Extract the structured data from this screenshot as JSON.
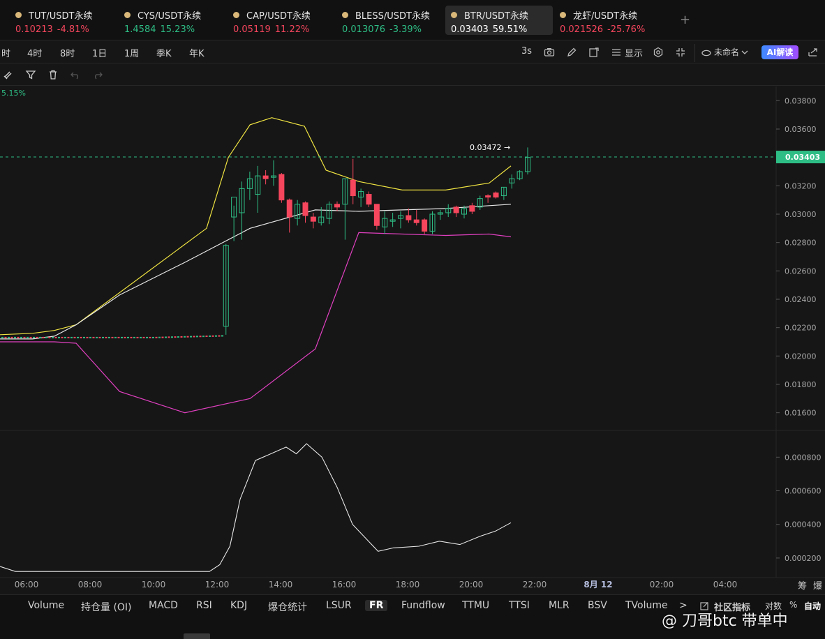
{
  "tabs": [
    {
      "pair": "TUT/USDT永续",
      "price": "0.10213",
      "change": "-4.81%",
      "dir": "down"
    },
    {
      "pair": "CYS/USDT永续",
      "price": "1.4584",
      "change": "15.23%",
      "dir": "up"
    },
    {
      "pair": "CAP/USDT永续",
      "price": "0.05119",
      "change": "11.22%",
      "dir": "down"
    },
    {
      "pair": "BLESS/USDT永续",
      "price": "0.013076",
      "change": "-3.39%",
      "dir": "up"
    },
    {
      "pair": "BTR/USDT永续",
      "price": "0.03403",
      "change": "59.51%",
      "dir": "active"
    },
    {
      "pair": "龙虾/USDT永续",
      "price": "0.021526",
      "change": "-25.76%",
      "dir": "down"
    }
  ],
  "add_tab": "+",
  "timeframes": [
    "时",
    "4时",
    "8时",
    "1日",
    "1周",
    "季K",
    "年K"
  ],
  "toolbar": {
    "interval": "3s",
    "display_label": "显示",
    "layout_name": "未命名",
    "ai_label": "AI解读"
  },
  "chart": {
    "change_label": "5.15%",
    "high_label": "0.03472 →",
    "last_price": "0.03403",
    "price_ticks": [
      "0.03800",
      "0.03600",
      "0.03400",
      "0.03200",
      "0.03000",
      "0.02800",
      "0.02600",
      "0.02400",
      "0.02200",
      "0.02000",
      "0.01800",
      "0.01600"
    ],
    "fr_ticks": [
      "0.000800",
      "0.000600",
      "0.000400",
      "0.000200"
    ],
    "time_ticks": [
      "06:00",
      "08:00",
      "10:00",
      "12:00",
      "14:00",
      "16:00",
      "18:00",
      "20:00",
      "22:00",
      "8月 12",
      "02:00",
      "04:00"
    ],
    "corner_labels": [
      "筹",
      "爆"
    ],
    "colors": {
      "up": "#2ebd85",
      "down": "#f6465d",
      "upper_band": "#f0e442",
      "mid_band": "#e6e6e6",
      "lower_band": "#e040c0",
      "last_price": "#2ebd85"
    }
  },
  "chart_data": {
    "type": "candlestick",
    "price_axis": {
      "min": 0.015,
      "max": 0.039,
      "unit": "USDT"
    },
    "fr_axis": {
      "min": 0.0001,
      "max": 0.00093
    },
    "last_price": 0.03403,
    "high_marker": 0.03472,
    "candles": [
      {
        "t": "12:30",
        "o": 0.0221,
        "h": 0.0279,
        "l": 0.0215,
        "c": 0.0278
      },
      {
        "t": "12:45",
        "o": 0.0298,
        "h": 0.0306,
        "l": 0.0281,
        "c": 0.0312
      },
      {
        "t": "13:00",
        "o": 0.0301,
        "h": 0.0323,
        "l": 0.0282,
        "c": 0.0318
      },
      {
        "t": "13:15",
        "o": 0.0318,
        "h": 0.033,
        "l": 0.031,
        "c": 0.0325
      },
      {
        "t": "13:30",
        "o": 0.0314,
        "h": 0.0334,
        "l": 0.0301,
        "c": 0.0327
      },
      {
        "t": "13:45",
        "o": 0.0327,
        "h": 0.0331,
        "l": 0.0321,
        "c": 0.0325
      },
      {
        "t": "14:00",
        "o": 0.0326,
        "h": 0.0338,
        "l": 0.032,
        "c": 0.0327
      },
      {
        "t": "14:15",
        "o": 0.0328,
        "h": 0.0329,
        "l": 0.0308,
        "c": 0.031
      },
      {
        "t": "14:30",
        "o": 0.031,
        "h": 0.0311,
        "l": 0.0287,
        "c": 0.0298
      },
      {
        "t": "14:45",
        "o": 0.0297,
        "h": 0.031,
        "l": 0.0292,
        "c": 0.0307
      },
      {
        "t": "15:00",
        "o": 0.0308,
        "h": 0.0309,
        "l": 0.0294,
        "c": 0.0299
      },
      {
        "t": "15:15",
        "o": 0.0298,
        "h": 0.0301,
        "l": 0.029,
        "c": 0.0295
      },
      {
        "t": "15:30",
        "o": 0.0294,
        "h": 0.0305,
        "l": 0.0292,
        "c": 0.0298
      },
      {
        "t": "15:45",
        "o": 0.0297,
        "h": 0.0309,
        "l": 0.0293,
        "c": 0.0307
      },
      {
        "t": "16:00",
        "o": 0.0307,
        "h": 0.0309,
        "l": 0.0302,
        "c": 0.0305
      },
      {
        "t": "16:15",
        "o": 0.0307,
        "h": 0.0325,
        "l": 0.0282,
        "c": 0.0325
      },
      {
        "t": "16:30",
        "o": 0.0324,
        "h": 0.0339,
        "l": 0.0307,
        "c": 0.0313
      },
      {
        "t": "16:45",
        "o": 0.0312,
        "h": 0.0318,
        "l": 0.0305,
        "c": 0.0316
      },
      {
        "t": "17:00",
        "o": 0.0314,
        "h": 0.0316,
        "l": 0.0305,
        "c": 0.0307
      },
      {
        "t": "17:15",
        "o": 0.0307,
        "h": 0.0307,
        "l": 0.0289,
        "c": 0.0292
      },
      {
        "t": "17:30",
        "o": 0.0291,
        "h": 0.0302,
        "l": 0.0286,
        "c": 0.0297
      },
      {
        "t": "17:45",
        "o": 0.0295,
        "h": 0.0301,
        "l": 0.0291,
        "c": 0.0296
      },
      {
        "t": "18:00",
        "o": 0.0297,
        "h": 0.0302,
        "l": 0.029,
        "c": 0.0299
      },
      {
        "t": "18:15",
        "o": 0.0299,
        "h": 0.0304,
        "l": 0.0294,
        "c": 0.0296
      },
      {
        "t": "18:30",
        "o": 0.0296,
        "h": 0.0303,
        "l": 0.0292,
        "c": 0.0294
      },
      {
        "t": "18:45",
        "o": 0.0296,
        "h": 0.0297,
        "l": 0.0286,
        "c": 0.0288
      },
      {
        "t": "19:00",
        "o": 0.0288,
        "h": 0.0302,
        "l": 0.0286,
        "c": 0.03
      },
      {
        "t": "19:15",
        "o": 0.03,
        "h": 0.0303,
        "l": 0.0296,
        "c": 0.0301
      },
      {
        "t": "19:30",
        "o": 0.0301,
        "h": 0.0307,
        "l": 0.0298,
        "c": 0.0304
      },
      {
        "t": "19:45",
        "o": 0.0305,
        "h": 0.0306,
        "l": 0.0298,
        "c": 0.0301
      },
      {
        "t": "20:00",
        "o": 0.03,
        "h": 0.0306,
        "l": 0.0297,
        "c": 0.0304
      },
      {
        "t": "20:15",
        "o": 0.0306,
        "h": 0.0308,
        "l": 0.03,
        "c": 0.0302
      },
      {
        "t": "20:30",
        "o": 0.0305,
        "h": 0.0313,
        "l": 0.0303,
        "c": 0.0311
      },
      {
        "t": "20:45",
        "o": 0.0313,
        "h": 0.0314,
        "l": 0.0308,
        "c": 0.0312
      },
      {
        "t": "21:00",
        "o": 0.0315,
        "h": 0.0316,
        "l": 0.0311,
        "c": 0.0312
      },
      {
        "t": "21:15",
        "o": 0.0313,
        "h": 0.0319,
        "l": 0.031,
        "c": 0.0319
      },
      {
        "t": "21:30",
        "o": 0.0322,
        "h": 0.0328,
        "l": 0.0318,
        "c": 0.0325
      },
      {
        "t": "21:45",
        "o": 0.0325,
        "h": 0.0331,
        "l": 0.0324,
        "c": 0.033
      },
      {
        "t": "22:00",
        "o": 0.033,
        "h": 0.0347,
        "l": 0.0328,
        "c": 0.034
      }
    ],
    "flat_segment": {
      "from": "04:00",
      "to": "12:15",
      "price": 0.0213
    },
    "bands": {
      "upper": [
        [
          0.0215,
          0.0215
        ],
        [
          0.0218,
          0.0216
        ],
        [
          0.022,
          0.0218
        ],
        [
          0.0222,
          0.0222
        ],
        [
          0.0234,
          0.029
        ],
        [
          0.0236,
          0.034
        ],
        [
          0.0238,
          0.0363
        ],
        [
          0.024,
          0.0368
        ],
        [
          0.0243,
          0.0362
        ],
        [
          0.0245,
          0.0331
        ],
        [
          0.0248,
          0.0323
        ],
        [
          0.0252,
          0.0317
        ],
        [
          0.0256,
          0.0317
        ],
        [
          0.026,
          0.0322
        ],
        [
          0.0262,
          0.0334
        ]
      ],
      "mid": [
        [
          0.0215,
          0.0212
        ],
        [
          0.0218,
          0.0212
        ],
        [
          0.022,
          0.0214
        ],
        [
          0.0222,
          0.0222
        ],
        [
          0.0226,
          0.0243
        ],
        [
          0.0232,
          0.0266
        ],
        [
          0.0238,
          0.029
        ],
        [
          0.0244,
          0.0303
        ],
        [
          0.0248,
          0.0302
        ],
        [
          0.0252,
          0.0303
        ],
        [
          0.0256,
          0.0304
        ],
        [
          0.026,
          0.0306
        ],
        [
          0.0262,
          0.0307
        ]
      ],
      "lower": [
        [
          0.0215,
          0.021
        ],
        [
          0.0218,
          0.021
        ],
        [
          0.022,
          0.021
        ],
        [
          0.0222,
          0.0209
        ],
        [
          0.0226,
          0.0175
        ],
        [
          0.0232,
          0.016
        ],
        [
          0.0238,
          0.017
        ],
        [
          0.0244,
          0.0205
        ],
        [
          0.0248,
          0.0287
        ],
        [
          0.0252,
          0.0286
        ],
        [
          0.0256,
          0.0285
        ],
        [
          0.026,
          0.0286
        ],
        [
          0.0262,
          0.0284
        ]
      ]
    },
    "funding_rate": [
      [
        0,
        0.00015
      ],
      [
        0.03,
        0.00012
      ],
      [
        0.08,
        0.00012
      ],
      [
        0.41,
        0.00012
      ],
      [
        0.43,
        0.00016
      ],
      [
        0.45,
        0.00027
      ],
      [
        0.47,
        0.00055
      ],
      [
        0.5,
        0.00078
      ],
      [
        0.53,
        0.00082
      ],
      [
        0.56,
        0.00086
      ],
      [
        0.58,
        0.00082
      ],
      [
        0.6,
        0.00088
      ],
      [
        0.63,
        0.0008
      ],
      [
        0.66,
        0.00062
      ],
      [
        0.69,
        0.0004
      ],
      [
        0.74,
        0.00024
      ],
      [
        0.77,
        0.00026
      ],
      [
        0.82,
        0.00027
      ],
      [
        0.86,
        0.0003
      ],
      [
        0.9,
        0.00028
      ],
      [
        0.94,
        0.00033
      ],
      [
        0.97,
        0.00036
      ],
      [
        1,
        0.00041
      ]
    ]
  },
  "indicators": [
    "Volume",
    "持仓量 (OI)",
    "MACD",
    "RSI",
    "KDJ",
    "爆仓统计",
    "LSUR",
    "FR",
    "Fundflow",
    "TTMU",
    "TTSI",
    "MLR",
    "BSV",
    "TVolume"
  ],
  "indicator_active": "FR",
  "indicator_right": {
    "more": ">",
    "community": "社区指标",
    "log": "对数",
    "percent": "%",
    "auto": "自动"
  },
  "watermark": "@ 刀哥btc 带单中"
}
